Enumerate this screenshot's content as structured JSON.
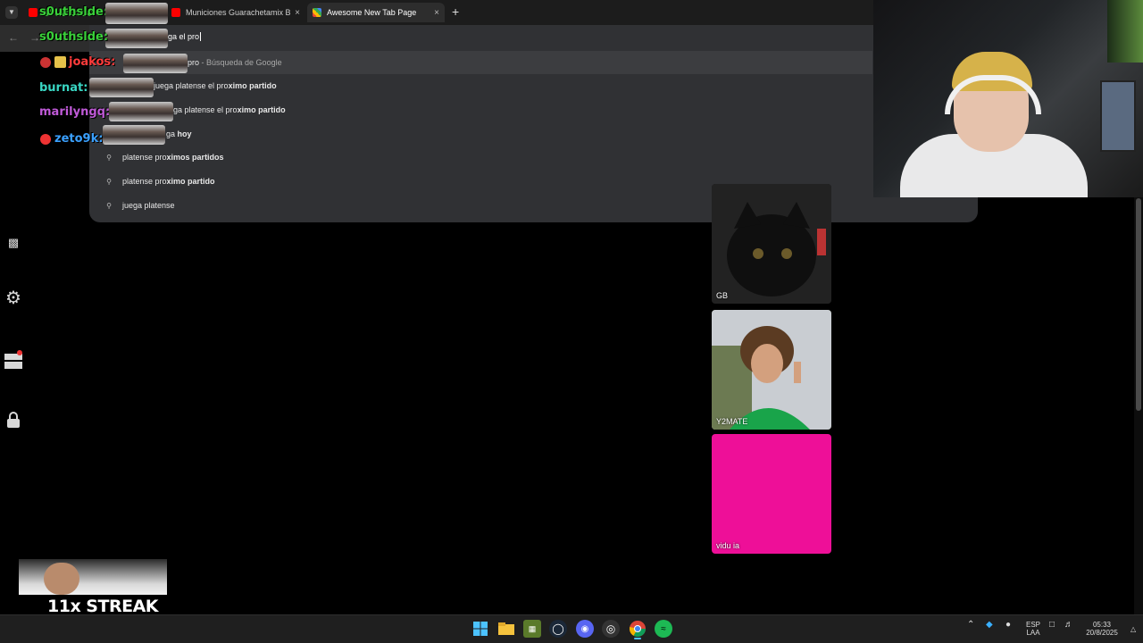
{
  "browser": {
    "tabs": [
      {
        "label": "s0uthslde:",
        "favicon_color": "#ff0000",
        "active": false
      },
      {
        "label": "Municiones Guarachetamix Bla",
        "favicon_color": "#ff0000",
        "active": false
      },
      {
        "label": "Awesome New Tab Page",
        "favicon_color": "#34a853",
        "active": true
      }
    ],
    "new_tab_glyph": "+",
    "close_glyph": "×",
    "omnibox": {
      "input_value": "ga el pro",
      "suggestions": [
        {
          "parts": [
            {
              "text": "pro",
              "bold": false
            },
            {
              "text": " - Búsqueda de Google",
              "muted": true
            }
          ],
          "icon": "search-icon",
          "selected": true
        },
        {
          "parts": [
            {
              "text": "juega platense el pro",
              "bold": false
            },
            {
              "text": "ximo partido",
              "bold": true
            }
          ],
          "icon": "search-icon"
        },
        {
          "parts": [
            {
              "text": "ga platense el pro",
              "bold": false
            },
            {
              "text": "ximo partido",
              "bold": true
            }
          ],
          "icon": "search-icon"
        },
        {
          "parts": [
            {
              "text": "ga ",
              "bold": false
            },
            {
              "text": "hoy",
              "bold": true
            }
          ],
          "icon": "search-icon"
        },
        {
          "parts": [
            {
              "text": "platense pro",
              "bold": false
            },
            {
              "text": "ximos partidos",
              "bold": true
            }
          ],
          "icon": "search-icon"
        },
        {
          "parts": [
            {
              "text": "platense pro",
              "bold": false
            },
            {
              "text": "ximo partido",
              "bold": true
            }
          ],
          "icon": "search-icon"
        },
        {
          "parts": [
            {
              "text": "juega platense",
              "bold": false
            }
          ],
          "icon": "search-icon"
        }
      ]
    }
  },
  "chat": [
    {
      "user": "s0uthslde:",
      "color": "#3ad13a"
    },
    {
      "user": "s0uthslde:",
      "color": "#3ad13a"
    },
    {
      "user": "joakos:",
      "color": "#ff3b3b"
    },
    {
      "user": "burnat:",
      "color": "#39d6c3"
    },
    {
      "user": "marilyngq:",
      "color": "#c05ad8"
    },
    {
      "user": "zeto9k:",
      "color": "#3aa0ff"
    }
  ],
  "tiles": [
    {
      "label": "GB",
      "color": "#2a2a2a"
    },
    {
      "label": "Y2MATE",
      "color": "#5f7d3f"
    },
    {
      "label": "vidu ia",
      "color": "#ee0f98"
    }
  ],
  "streak": {
    "text": "11x STREAK"
  },
  "taskbar": {
    "lang_top": "ESP",
    "lang_bottom": "LAA",
    "time": "05:33",
    "date": "20/8/2025"
  }
}
